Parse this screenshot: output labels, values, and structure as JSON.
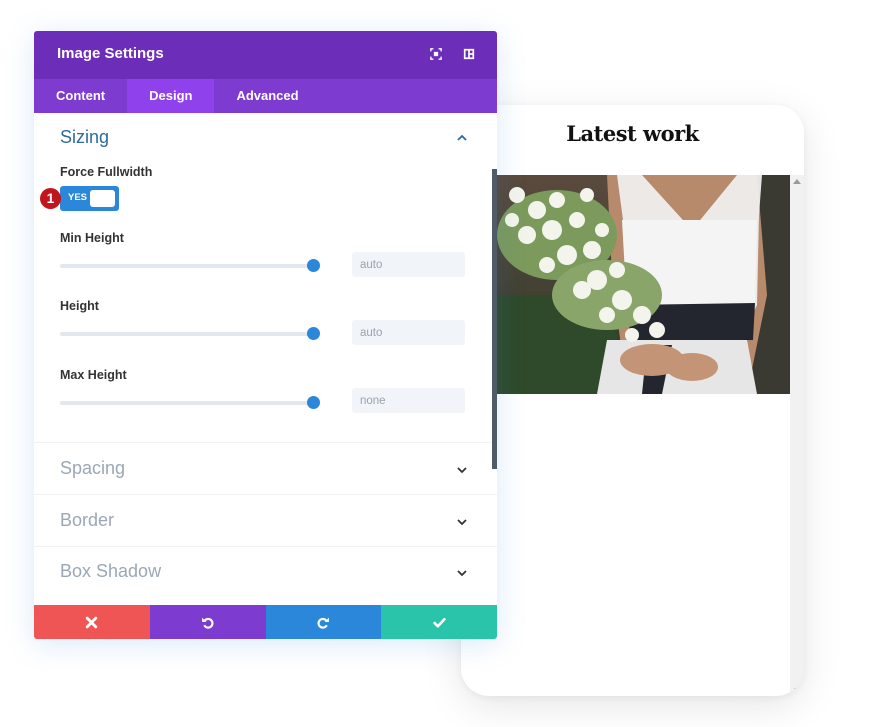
{
  "panel": {
    "title": "Image Settings",
    "header_icons": [
      "fullscreen-icon",
      "sidebar-layout-icon"
    ],
    "tabs": [
      {
        "label": "Content",
        "active": false
      },
      {
        "label": "Design",
        "active": true
      },
      {
        "label": "Advanced",
        "active": false
      }
    ],
    "sizing": {
      "title": "Sizing",
      "expanded": true,
      "force_fullwidth": {
        "label": "Force Fullwidth",
        "value": "YES",
        "on": true
      },
      "step_badge": "1",
      "min_height": {
        "label": "Min Height",
        "value": "auto",
        "slider_percent": 100
      },
      "height": {
        "label": "Height",
        "value": "auto",
        "slider_percent": 100
      },
      "max_height": {
        "label": "Max Height",
        "value": "none",
        "slider_percent": 100
      }
    },
    "collapsed_groups": [
      {
        "title": "Spacing"
      },
      {
        "title": "Border"
      },
      {
        "title": "Box Shadow"
      }
    ],
    "actions": [
      {
        "name": "discard",
        "icon": "close-icon",
        "color": "#ef5555"
      },
      {
        "name": "undo",
        "icon": "undo-icon",
        "color": "#7e3bd0"
      },
      {
        "name": "redo",
        "icon": "redo-icon",
        "color": "#2b87da"
      },
      {
        "name": "save",
        "icon": "check-icon",
        "color": "#29c4a9"
      }
    ]
  },
  "preview": {
    "title": "Latest work",
    "image_alt": "bride holding white flower bouquet"
  },
  "colors": {
    "header": "#6c2eb9",
    "tabs": "#7e3bd0",
    "tab_active": "#8f42ec",
    "accent": "#2b87da",
    "badge": "#c0161d"
  }
}
